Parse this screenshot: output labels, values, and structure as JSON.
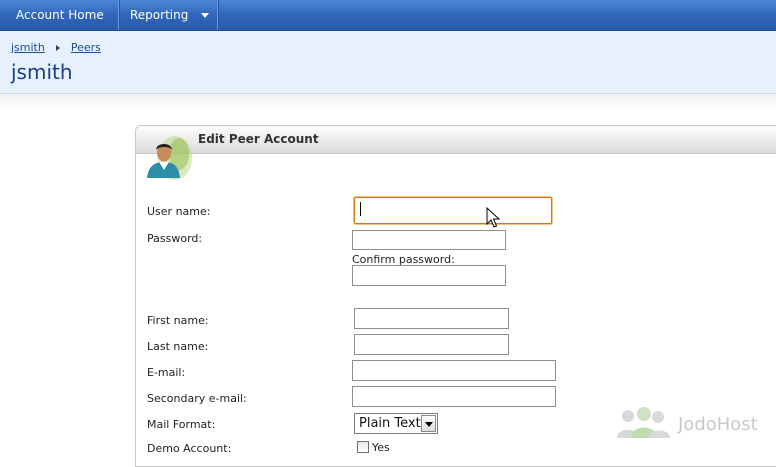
{
  "nav": {
    "items": [
      {
        "label": "Account Home"
      },
      {
        "label": "Reporting"
      }
    ]
  },
  "breadcrumb": [
    "jsmith",
    "Peers"
  ],
  "page": {
    "title": "jsmith"
  },
  "panel": {
    "title": "Edit Peer Account"
  },
  "form": {
    "username_label": "User name:",
    "username_value": "",
    "password_label": "Password:",
    "confirm_label": "Confirm password:",
    "firstname_label": "First name:",
    "lastname_label": "Last name:",
    "email_label": "E-mail:",
    "secondary_email_label": "Secondary e-mail:",
    "mail_format_label": "Mail Format:",
    "mail_format_selected": "Plain Text",
    "demo_label": "Demo Account:",
    "demo_option": "Yes",
    "demo_checked": false
  },
  "watermark": {
    "text": "JodoHost"
  },
  "colors": {
    "nav_bg": "#2f64b8",
    "header_bg": "#e6f1fc",
    "title": "#16407f",
    "focus_border": "#c97a1a"
  },
  "icons": [
    "user-avatar-icon",
    "mouse-cursor-icon",
    "dropdown-arrow-icon",
    "breadcrumb-separator-icon",
    "jodohost-logo-icon"
  ]
}
